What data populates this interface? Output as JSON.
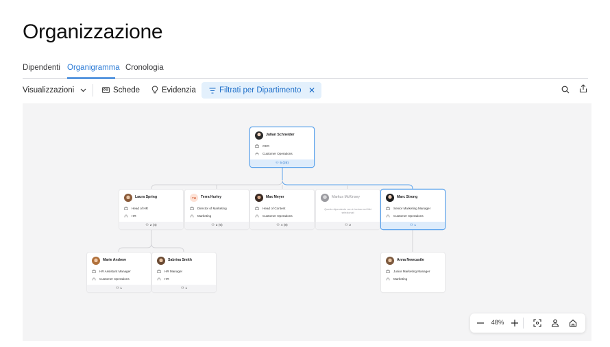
{
  "page": {
    "title": "Organizzazione"
  },
  "tabs": [
    {
      "label": "Dipendenti",
      "active": false
    },
    {
      "label": "Organigramma",
      "active": true
    },
    {
      "label": "Cronologia",
      "active": false
    }
  ],
  "toolbar": {
    "views_label": "Visualizzazioni",
    "cards_label": "Schede",
    "highlight_label": "Evidenzia",
    "filter_label": "Filtrati per Dipartimento"
  },
  "org": {
    "ceo": {
      "name": "Julian Schneider",
      "title": "CEO",
      "department": "Customer Operations",
      "reports": "5 (26)"
    },
    "laura": {
      "name": "Laura Spring",
      "title": "Head of HR",
      "department": "HR",
      "reports": "2 (4)"
    },
    "terra": {
      "name": "Terra Hurley",
      "initials": "TH",
      "title": "Director of Marketing",
      "department": "Marketing",
      "reports": "2 (6)"
    },
    "max": {
      "name": "Max Meyer",
      "title": "Head of Content",
      "department": "Customer Operations",
      "reports": "4 (8)"
    },
    "markus": {
      "name": "Markus McKinsey",
      "note": "Questo dipendente non è incluso nei filtri selezionati",
      "reports": "2"
    },
    "marc": {
      "name": "Marc Strong",
      "title": "Senior Marketing Manager",
      "department": "Customer Operations",
      "reports": "1"
    },
    "marie": {
      "name": "Marie Andrew",
      "title": "HR Assistant Manager",
      "department": "Customer Operations",
      "reports": "1"
    },
    "sabrina": {
      "name": "Sabrina Smith",
      "title": "HR Manager",
      "department": "HR",
      "reports": "1"
    },
    "anna": {
      "name": "Anna Newcastle",
      "title": "Junior Marketing Manager",
      "department": "Marketing"
    }
  },
  "zoom": {
    "level": "48%"
  },
  "colors": {
    "accent": "#2a7ad6",
    "selected_border": "#5aa2ec",
    "canvas": "#f4f4f5"
  }
}
